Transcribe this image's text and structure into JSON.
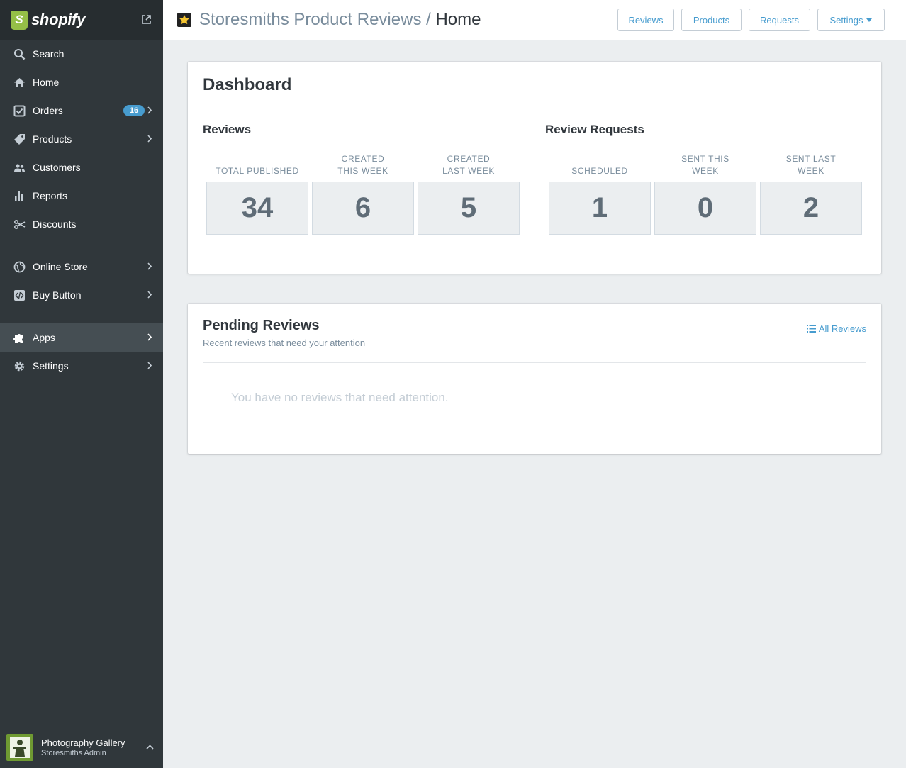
{
  "brand": {
    "name": "shopify"
  },
  "sidebar": {
    "items": [
      {
        "label": "Search",
        "icon": "search-icon"
      },
      {
        "label": "Home",
        "icon": "home-icon"
      },
      {
        "label": "Orders",
        "icon": "orders-icon",
        "badge": "16"
      },
      {
        "label": "Products",
        "icon": "tag-icon"
      },
      {
        "label": "Customers",
        "icon": "customers-icon"
      },
      {
        "label": "Reports",
        "icon": "bar-chart-icon"
      },
      {
        "label": "Discounts",
        "icon": "discount-icon"
      },
      {
        "label": "Online Store",
        "icon": "globe-icon"
      },
      {
        "label": "Buy Button",
        "icon": "code-icon"
      },
      {
        "label": "Apps",
        "icon": "puzzle-icon"
      },
      {
        "label": "Settings",
        "icon": "gear-icon"
      }
    ],
    "account": {
      "name": "Photography Gallery",
      "role": "Storesmiths Admin"
    }
  },
  "topbar": {
    "app_name": "Storesmiths Product Reviews",
    "separator": " / ",
    "current_page": "Home",
    "buttons": {
      "reviews": "Reviews",
      "products": "Products",
      "requests": "Requests",
      "settings": "Settings"
    }
  },
  "dashboard": {
    "title": "Dashboard",
    "reviews": {
      "title": "Reviews",
      "stats": [
        {
          "label": "Total Published",
          "value": "34"
        },
        {
          "label": "Created This Week",
          "value": "6"
        },
        {
          "label": "Created Last Week",
          "value": "5"
        }
      ]
    },
    "requests": {
      "title": "Review Requests",
      "stats": [
        {
          "label": "Scheduled",
          "value": "1"
        },
        {
          "label": "Sent This Week",
          "value": "0"
        },
        {
          "label": "Sent Last Week",
          "value": "2"
        }
      ]
    }
  },
  "pending": {
    "title": "Pending Reviews",
    "subtitle": "Recent reviews that need your attention",
    "link": "All Reviews",
    "empty": "You have no reviews that need attention."
  },
  "colors": {
    "sidebar": "#30373b",
    "accent": "#479ccf",
    "brand_green": "#95bf47",
    "badge": "#479ccf"
  }
}
